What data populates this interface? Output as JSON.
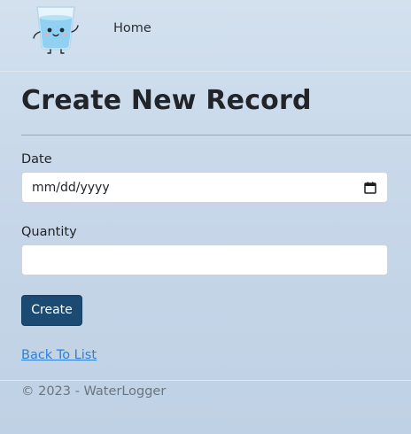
{
  "nav": {
    "home_label": "Home"
  },
  "page": {
    "title": "Create New Record"
  },
  "form": {
    "date_label": "Date",
    "date_value": "mm/dd/yyyy",
    "quantity_label": "Quantity",
    "quantity_value": "",
    "submit_label": "Create"
  },
  "links": {
    "back_label": "Back To List"
  },
  "footer": {
    "text": "© 2023 - WaterLogger"
  },
  "icons": {
    "logo": "water-glass-mascot-icon",
    "date_picker": "calendar-icon"
  },
  "colors": {
    "primary_button": "#1b4a73",
    "link": "#2f7fd6",
    "footer_text": "#6c757d"
  }
}
